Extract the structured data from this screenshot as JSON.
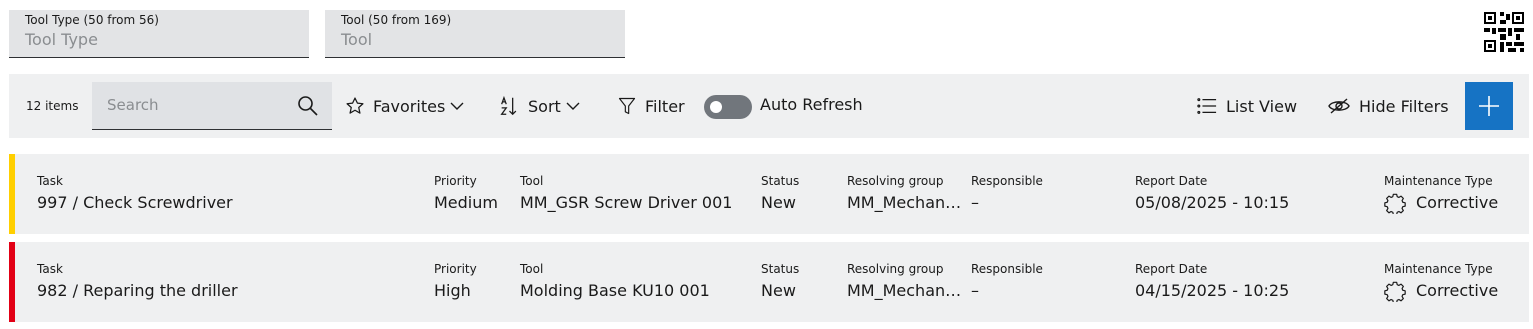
{
  "filters": {
    "tool_type": {
      "label": "Tool Type (50 from 56)",
      "placeholder": "Tool Type"
    },
    "tool": {
      "label": "Tool (50 from 169)",
      "placeholder": "Tool"
    }
  },
  "toolbar": {
    "item_count": "12 items",
    "search_placeholder": "Search",
    "favorites_label": "Favorites",
    "sort_label": "Sort",
    "filter_label": "Filter",
    "auto_refresh_label": "Auto Refresh",
    "auto_refresh_on": false,
    "list_view_label": "List View",
    "hide_filters_label": "Hide Filters"
  },
  "columns": {
    "task": "Task",
    "priority": "Priority",
    "tool": "Tool",
    "status": "Status",
    "resolving_group": "Resolving group",
    "responsible": "Responsible",
    "report_date": "Report Date",
    "maintenance_type": "Maintenance Type"
  },
  "rows": [
    {
      "task": "997 / Check Screwdriver",
      "priority": "Medium",
      "priority_color": "#ffcf00",
      "tool": "MM_GSR Screw Driver 001",
      "status": "New",
      "resolving_group": "MM_Mechanical",
      "responsible": "–",
      "report_date": "05/08/2025 - 10:15",
      "maintenance_type": "Corrective",
      "maintenance_icon": "gear-icon"
    },
    {
      "task": "982 / Reparing the driller",
      "priority": "High",
      "priority_color": "#e20015",
      "tool": "Molding Base KU10 001",
      "status": "New",
      "resolving_group": "MM_Mechanical",
      "responsible": "–",
      "report_date": "04/15/2025 - 10:25",
      "maintenance_type": "Corrective",
      "maintenance_icon": "gear-icon"
    }
  ],
  "colors": {
    "accent": "#1673c4",
    "toolbar_bg": "#eff0f1",
    "field_bg": "#e3e4e6"
  }
}
